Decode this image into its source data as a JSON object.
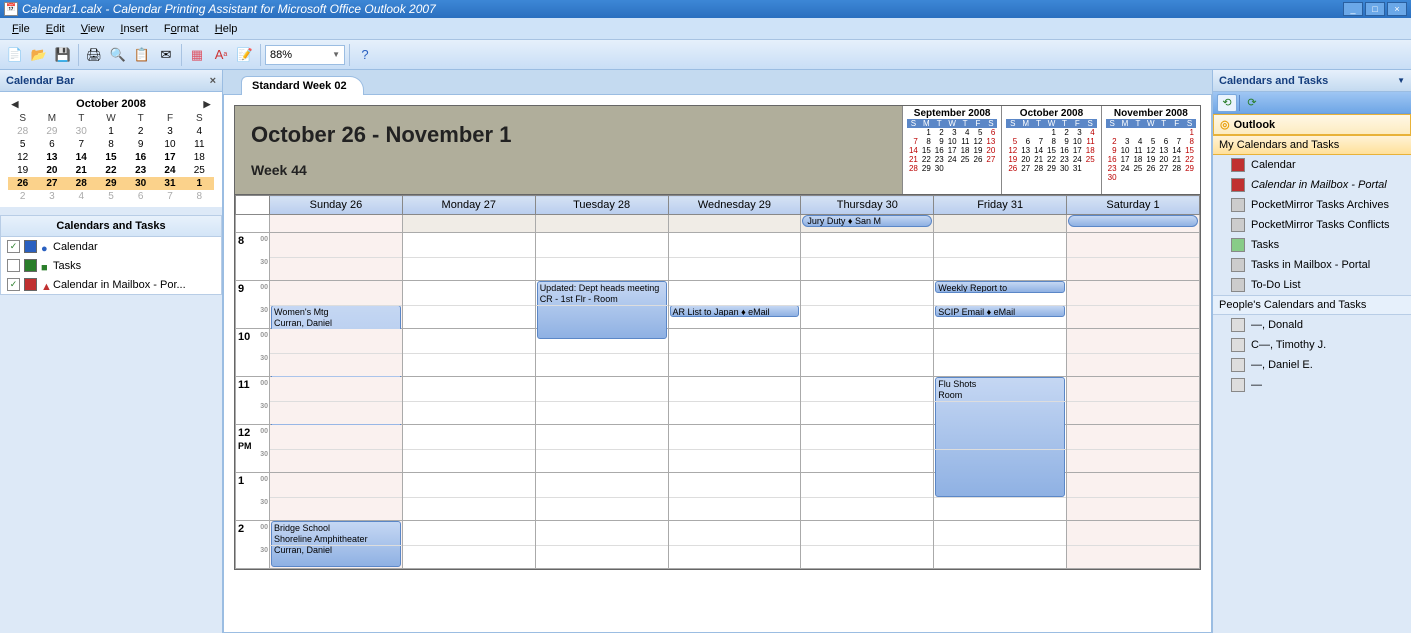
{
  "titlebar": {
    "title": "Calendar1.calx - Calendar Printing Assistant for Microsoft Office Outlook 2007"
  },
  "menubar": {
    "file": "File",
    "edit": "Edit",
    "view": "View",
    "insert": "Insert",
    "format": "Format",
    "help": "Help"
  },
  "toolbar": {
    "zoom": "88%"
  },
  "left": {
    "header": "Calendar Bar",
    "month_title": "October 2008",
    "dow": [
      "S",
      "M",
      "T",
      "W",
      "T",
      "F",
      "S"
    ],
    "weeks": [
      {
        "hl": false,
        "cells": [
          {
            "v": "28",
            "dim": true
          },
          {
            "v": "29",
            "dim": true
          },
          {
            "v": "30",
            "dim": true
          },
          {
            "v": "1"
          },
          {
            "v": "2"
          },
          {
            "v": "3"
          },
          {
            "v": "4"
          }
        ]
      },
      {
        "hl": false,
        "cells": [
          {
            "v": "5"
          },
          {
            "v": "6"
          },
          {
            "v": "7"
          },
          {
            "v": "8"
          },
          {
            "v": "9"
          },
          {
            "v": "10"
          },
          {
            "v": "11"
          }
        ]
      },
      {
        "hl": false,
        "cells": [
          {
            "v": "12"
          },
          {
            "v": "13",
            "b": true
          },
          {
            "v": "14",
            "b": true
          },
          {
            "v": "15",
            "b": true
          },
          {
            "v": "16",
            "b": true
          },
          {
            "v": "17",
            "b": true
          },
          {
            "v": "18"
          }
        ]
      },
      {
        "hl": false,
        "cells": [
          {
            "v": "19"
          },
          {
            "v": "20",
            "b": true
          },
          {
            "v": "21",
            "b": true
          },
          {
            "v": "22",
            "b": true
          },
          {
            "v": "23",
            "b": true
          },
          {
            "v": "24",
            "b": true
          },
          {
            "v": "25"
          }
        ]
      },
      {
        "hl": true,
        "cells": [
          {
            "v": "26",
            "b": true
          },
          {
            "v": "27",
            "b": true
          },
          {
            "v": "28",
            "b": true
          },
          {
            "v": "29",
            "b": true
          },
          {
            "v": "30",
            "b": true
          },
          {
            "v": "31",
            "b": true
          },
          {
            "v": "1",
            "b": true
          }
        ]
      },
      {
        "hl": false,
        "cells": [
          {
            "v": "2",
            "dim": true
          },
          {
            "v": "3",
            "dim": true
          },
          {
            "v": "4",
            "dim": true
          },
          {
            "v": "5",
            "dim": true
          },
          {
            "v": "6",
            "dim": true
          },
          {
            "v": "7",
            "dim": true
          },
          {
            "v": "8",
            "dim": true
          }
        ]
      }
    ],
    "caltasks_header": "Calendars and Tasks",
    "ct_items": [
      {
        "checked": true,
        "label": "Calendar"
      },
      {
        "checked": false,
        "label": "Tasks"
      },
      {
        "checked": true,
        "label": "Calendar in Mailbox - Por..."
      }
    ]
  },
  "center": {
    "tab": "Standard Week 02",
    "range_title": "October 26 - November 1",
    "week": "Week 44",
    "mini3": [
      {
        "title": "September 2008"
      },
      {
        "title": "October 2008"
      },
      {
        "title": "November 2008"
      }
    ],
    "day_headers": [
      "Sunday 26",
      "Monday 27",
      "Tuesday 28",
      "Wednesday 29",
      "Thursday 30",
      "Friday 31",
      "Saturday 1"
    ],
    "events": {
      "allday_thu": "Jury Duty ♦ San M",
      "allday_sat": "",
      "sun_womens": "Women's Mtg\nCurran, Daniel",
      "sun_bridge": "Bridge School\nShoreline Amphitheater\nCurran, Daniel",
      "tue_dept": "Updated: Dept heads meeting\nCR - 1st Flr - Room",
      "wed_ar": "AR List to Japan ♦ eMail",
      "fri_weekly": "Weekly Report to",
      "fri_scip": "SCIP Email ♦ eMail",
      "fri_flu": "Flu Shots\nRoom"
    },
    "hours": [
      "8",
      "9",
      "10",
      "11",
      "12 PM",
      "1",
      "2"
    ]
  },
  "right": {
    "header": "Calendars and Tasks",
    "outlook": "Outlook",
    "my_hdr": "My Calendars and Tasks",
    "my_items": [
      "Calendar",
      "Calendar in Mailbox - Portal",
      "PocketMirror Tasks Archives",
      "PocketMirror Tasks Conflicts",
      "Tasks",
      "Tasks in Mailbox - Portal",
      "To-Do List"
    ],
    "people_hdr": "People's Calendars and Tasks",
    "people_items": [
      "—, Donald",
      "C—, Timothy J.",
      "—, Daniel E.",
      "—"
    ]
  }
}
